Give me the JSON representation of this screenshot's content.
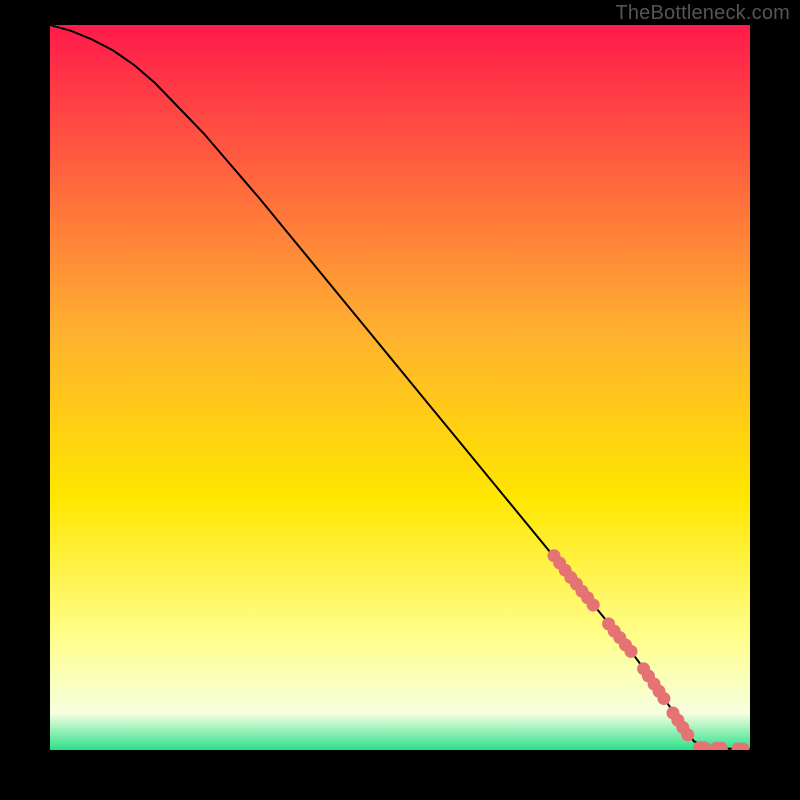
{
  "attribution": "TheBottleneck.com",
  "colors": {
    "line": "#000000",
    "marker": "#e57373",
    "gradient_top": "#ff1a4b",
    "gradient_mid_upper": "#ffb030",
    "gradient_mid": "#ffe600",
    "gradient_mid_lower": "#ffff90",
    "gradient_low": "#f5ffe0",
    "gradient_bottom": "#2be08a",
    "background": "#000000"
  },
  "chart_data": {
    "type": "line",
    "title": "",
    "xlabel": "",
    "ylabel": "",
    "xlim": [
      0,
      100
    ],
    "ylim": [
      0,
      100
    ],
    "series": [
      {
        "name": "curve",
        "x": [
          0,
          3,
          6,
          9,
          12,
          15,
          18,
          22,
          26,
          30,
          34,
          38,
          42,
          46,
          50,
          54,
          58,
          62,
          66,
          70,
          74,
          78,
          82,
          85,
          87.5,
          90,
          92,
          94,
          96,
          98,
          100
        ],
        "y": [
          100,
          99.2,
          98,
          96.5,
          94.5,
          92,
          89,
          85,
          80.5,
          76,
          71.3,
          66.6,
          61.9,
          57.2,
          52.5,
          47.8,
          43.1,
          38.4,
          33.7,
          29,
          24.3,
          19.6,
          14.9,
          11,
          7.5,
          3.8,
          1.2,
          0.3,
          0.2,
          0.15,
          0.1
        ]
      }
    ],
    "markers": [
      {
        "x": 72.0,
        "y": 26.8
      },
      {
        "x": 72.8,
        "y": 25.8
      },
      {
        "x": 73.6,
        "y": 24.8
      },
      {
        "x": 74.4,
        "y": 23.8
      },
      {
        "x": 75.2,
        "y": 22.9
      },
      {
        "x": 76.0,
        "y": 21.9
      },
      {
        "x": 76.8,
        "y": 21.0
      },
      {
        "x": 77.6,
        "y": 20.0
      },
      {
        "x": 79.8,
        "y": 17.4
      },
      {
        "x": 80.6,
        "y": 16.4
      },
      {
        "x": 81.4,
        "y": 15.5
      },
      {
        "x": 82.2,
        "y": 14.5
      },
      {
        "x": 83.0,
        "y": 13.6
      },
      {
        "x": 84.8,
        "y": 11.2
      },
      {
        "x": 85.5,
        "y": 10.2
      },
      {
        "x": 86.3,
        "y": 9.1
      },
      {
        "x": 87.0,
        "y": 8.1
      },
      {
        "x": 87.7,
        "y": 7.1
      },
      {
        "x": 89.0,
        "y": 5.1
      },
      {
        "x": 89.7,
        "y": 4.1
      },
      {
        "x": 90.4,
        "y": 3.1
      },
      {
        "x": 91.1,
        "y": 2.1
      },
      {
        "x": 92.8,
        "y": 0.35
      },
      {
        "x": 93.5,
        "y": 0.3
      },
      {
        "x": 95.2,
        "y": 0.25
      },
      {
        "x": 95.9,
        "y": 0.22
      },
      {
        "x": 98.3,
        "y": 0.15
      },
      {
        "x": 99.0,
        "y": 0.12
      }
    ]
  }
}
